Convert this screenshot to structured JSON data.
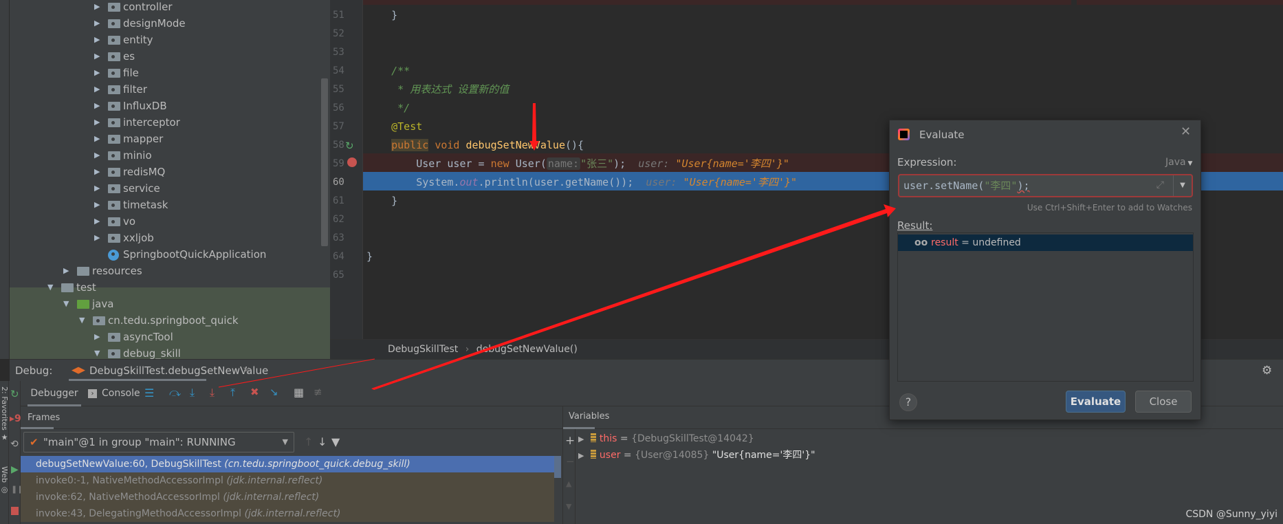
{
  "project_tree": {
    "items": [
      {
        "label": "controller",
        "level": 3,
        "arrow": "▶",
        "icon": "package"
      },
      {
        "label": "designMode",
        "level": 3,
        "arrow": "▶",
        "icon": "package"
      },
      {
        "label": "entity",
        "level": 3,
        "arrow": "▶",
        "icon": "package"
      },
      {
        "label": "es",
        "level": 3,
        "arrow": "▶",
        "icon": "package"
      },
      {
        "label": "file",
        "level": 3,
        "arrow": "▶",
        "icon": "package"
      },
      {
        "label": "filter",
        "level": 3,
        "arrow": "▶",
        "icon": "package"
      },
      {
        "label": "InfluxDB",
        "level": 3,
        "arrow": "▶",
        "icon": "package"
      },
      {
        "label": "interceptor",
        "level": 3,
        "arrow": "▶",
        "icon": "package"
      },
      {
        "label": "mapper",
        "level": 3,
        "arrow": "▶",
        "icon": "package"
      },
      {
        "label": "minio",
        "level": 3,
        "arrow": "▶",
        "icon": "package"
      },
      {
        "label": "redisMQ",
        "level": 3,
        "arrow": "▶",
        "icon": "package"
      },
      {
        "label": "service",
        "level": 3,
        "arrow": "▶",
        "icon": "package"
      },
      {
        "label": "timetask",
        "level": 3,
        "arrow": "▶",
        "icon": "package"
      },
      {
        "label": "vo",
        "level": 3,
        "arrow": "▶",
        "icon": "package"
      },
      {
        "label": "xxljob",
        "level": 3,
        "arrow": "▶",
        "icon": "package"
      },
      {
        "label": "SpringbootQuickApplication",
        "level": 3,
        "arrow": "",
        "icon": "spring-boot-class"
      },
      {
        "label": "resources",
        "level": 1,
        "arrow": "▶",
        "icon": "resources-folder"
      },
      {
        "label": "test",
        "level": 0,
        "arrow": "▼",
        "icon": "folder"
      },
      {
        "label": "java",
        "level": 1,
        "arrow": "▼",
        "icon": "test-source-folder"
      },
      {
        "label": "cn.tedu.springboot_quick",
        "level": 2,
        "arrow": "▼",
        "icon": "package"
      },
      {
        "label": "asyncTool",
        "level": 3,
        "arrow": "▶",
        "icon": "package"
      },
      {
        "label": "debug_skill",
        "level": 3,
        "arrow": "▼",
        "icon": "package"
      }
    ]
  },
  "editor": {
    "lines": [
      {
        "n": "51",
        "tokens": [
          {
            "t": "    }",
            "c": ""
          }
        ]
      },
      {
        "n": "52",
        "tokens": []
      },
      {
        "n": "53",
        "tokens": []
      },
      {
        "n": "54",
        "tokens": [
          {
            "t": "    /**",
            "c": "cm"
          }
        ]
      },
      {
        "n": "55",
        "tokens": [
          {
            "t": "     * 用表达式 设置新的值",
            "c": "cm"
          }
        ]
      },
      {
        "n": "56",
        "tokens": [
          {
            "t": "     */",
            "c": "cm"
          }
        ]
      },
      {
        "n": "57",
        "tokens": [
          {
            "t": "    ",
            "c": ""
          },
          {
            "t": "@Test",
            "c": "ann"
          }
        ]
      },
      {
        "n": "58",
        "tokens": [
          {
            "t": "    ",
            "c": ""
          },
          {
            "t": "public",
            "c": "kw pubhl"
          },
          {
            "t": " void ",
            "c": "kw"
          },
          {
            "t": "debugSetNewValue",
            "c": "fn"
          },
          {
            "t": "(){",
            "c": ""
          }
        ]
      },
      {
        "n": "59",
        "tokens": [
          {
            "t": "        User user = ",
            "c": ""
          },
          {
            "t": "new ",
            "c": "kw"
          },
          {
            "t": "User(",
            "c": ""
          },
          {
            "t": "name:",
            "c": "hint"
          },
          {
            "t": "\"张三\"",
            "c": "str"
          },
          {
            "t": ");",
            "c": ""
          },
          {
            "t": "  user: ",
            "c": "inl"
          },
          {
            "t": "\"User{name='李四'}\"",
            "c": "inls"
          }
        ]
      },
      {
        "n": "60",
        "tokens": [
          {
            "t": "        System.",
            "c": ""
          },
          {
            "t": "out",
            "c": "st"
          },
          {
            "t": ".println(user.getName());",
            "c": ""
          },
          {
            "t": "  user: ",
            "c": "inl"
          },
          {
            "t": "\"User{name='李四'}\"",
            "c": "inls"
          }
        ]
      },
      {
        "n": "61",
        "tokens": [
          {
            "t": "    }",
            "c": ""
          }
        ]
      },
      {
        "n": "62",
        "tokens": []
      },
      {
        "n": "63",
        "tokens": []
      },
      {
        "n": "64",
        "tokens": [
          {
            "t": "}",
            "c": ""
          }
        ]
      },
      {
        "n": "65",
        "tokens": []
      }
    ],
    "breadcrumb": [
      "DebugSkillTest",
      "debugSetNewValue()"
    ],
    "breadcrumb_sep": "›"
  },
  "debug": {
    "label": "Debug:",
    "session_tab": "DebugSkillTest.debugSetNewValue",
    "tabs": [
      "Debugger",
      "Console"
    ],
    "frames_tab": "Frames",
    "variables_tab": "Variables",
    "thread": "\"main\"@1 in group \"main\": RUNNING",
    "frames": [
      {
        "method": "debugSetNewValue:60, DebugSkillTest",
        "pkg": "(cn.tedu.springboot_quick.debug_skill)",
        "selected": true
      },
      {
        "method": "invoke0:-1, NativeMethodAccessorImpl",
        "pkg": "(jdk.internal.reflect)"
      },
      {
        "method": "invoke:62, NativeMethodAccessorImpl",
        "pkg": "(jdk.internal.reflect)"
      },
      {
        "method": "invoke:43, DelegatingMethodAccessorImpl",
        "pkg": "(jdk.internal.reflect)"
      }
    ],
    "variables": [
      {
        "name": "this",
        "eq": " = ",
        "ref": "{DebugSkillTest@14042}",
        "value": ""
      },
      {
        "name": "user",
        "eq": " = ",
        "ref": "{User@14085}",
        "value": " \"User{name='李四'}\""
      }
    ],
    "side_labels": [
      "2: Favorites",
      "Web"
    ]
  },
  "evaluate_dialog": {
    "title": "Evaluate",
    "expression_label": "Expression:",
    "language": "Java",
    "expression_code": "user.setName(",
    "expression_string": "\"李四\"",
    "expression_end": ");",
    "hint": "Use Ctrl+Shift+Enter to add to Watches",
    "result_label": "Result:",
    "result_name": "result",
    "result_eq": " = ",
    "result_value": "undefined",
    "evaluate_button": "Evaluate",
    "close_button": "Close",
    "help": "?"
  },
  "watermark": "CSDN @Sunny_yiyi",
  "colors": {
    "accent": "#4b6eaf",
    "current_line": "#2f65a0",
    "breakpoint_line": "#3b2626",
    "annotation_arrow": "#ff1a1a"
  }
}
